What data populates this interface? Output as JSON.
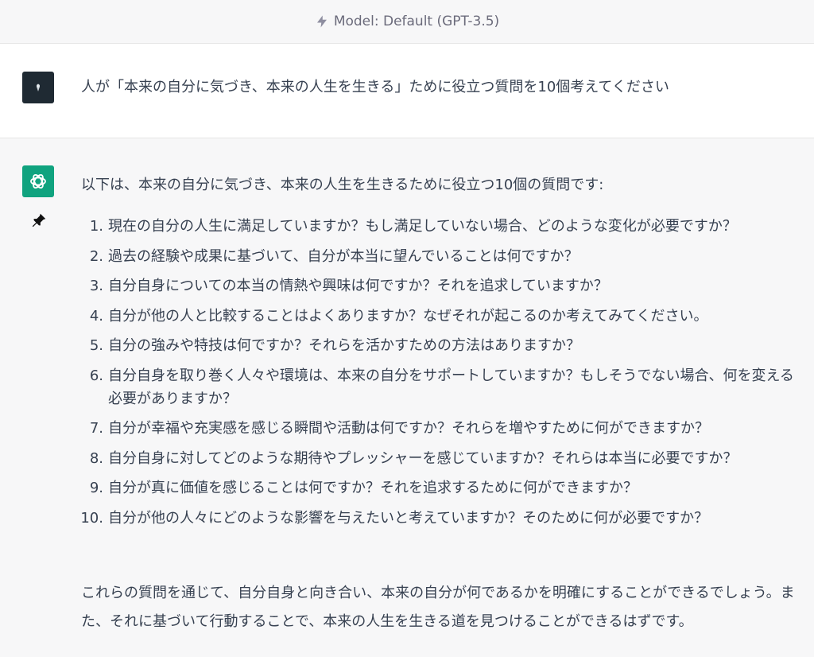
{
  "header": {
    "model_label": "Model: Default (GPT-3.5)",
    "icon": "lightning-bolt-icon"
  },
  "user_message": {
    "avatar": "user-avatar",
    "text": "人が「本来の自分に気づき、本来の人生を生きる」ために役立つ質問を10個考えてください"
  },
  "assistant_message": {
    "avatar": "chatgpt-logo-icon",
    "pin_icon": "pin-icon",
    "intro": "以下は、本来の自分に気づき、本来の人生を生きるために役立つ10個の質問です:",
    "questions": [
      {
        "num": "1.",
        "text": "現在の自分の人生に満足していますか？もし満足していない場合、どのような変化が必要ですか？"
      },
      {
        "num": "2.",
        "text": "過去の経験や成果に基づいて、自分が本当に望んでいることは何ですか？"
      },
      {
        "num": "3.",
        "text": "自分自身についての本当の情熱や興味は何ですか？それを追求していますか？"
      },
      {
        "num": "4.",
        "text": "自分が他の人と比較することはよくありますか？なぜそれが起こるのか考えてみてください。"
      },
      {
        "num": "5.",
        "text": "自分の強みや特技は何ですか？それらを活かすための方法はありますか？"
      },
      {
        "num": "6.",
        "text": "自分自身を取り巻く人々や環境は、本来の自分をサポートしていますか？もしそうでない場合、何を変える必要がありますか？"
      },
      {
        "num": "7.",
        "text": "自分が幸福や充実感を感じる瞬間や活動は何ですか？それらを増やすために何ができますか？"
      },
      {
        "num": "8.",
        "text": "自分自身に対してどのような期待やプレッシャーを感じていますか？それらは本当に必要ですか？"
      },
      {
        "num": "9.",
        "text": "自分が真に価値を感じることは何ですか？それを追求するために何ができますか？"
      },
      {
        "num": "10.",
        "text": "自分が他の人々にどのような影響を与えたいと考えていますか？そのために何が必要ですか？"
      }
    ],
    "outro": "これらの質問を通じて、自分自身と向き合い、本来の自分が何であるかを明確にすることができるでしょう。また、それに基づいて行動することで、本来の人生を生きる道を見つけることができるはずです。"
  },
  "colors": {
    "chatgpt_green": "#10a37f",
    "user_avatar_bg": "#1f2a33",
    "text": "#374151",
    "assistant_bg": "#f7f7f8",
    "user_bg": "#ffffff"
  }
}
